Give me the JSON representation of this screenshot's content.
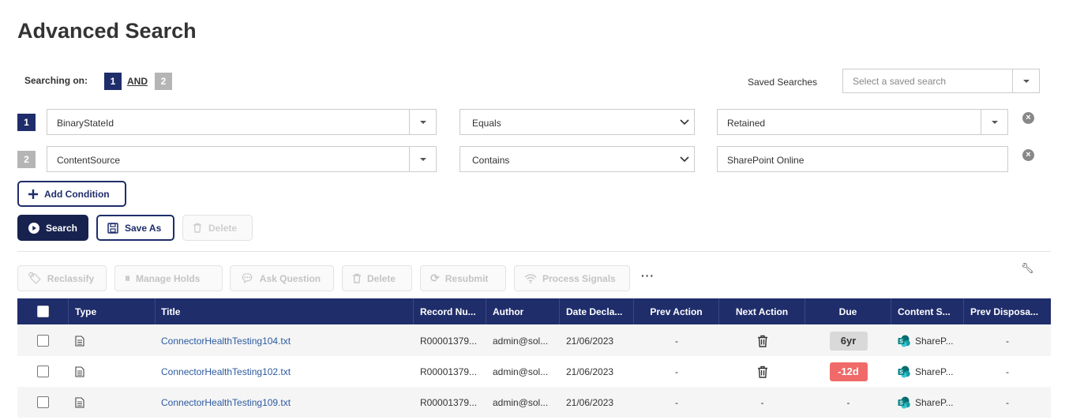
{
  "page_title": "Advanced Search",
  "searching": {
    "label": "Searching on:",
    "badge_1": "1",
    "operator": "AND",
    "badge_2": "2"
  },
  "saved_searches": {
    "label": "Saved Searches",
    "placeholder": "Select a saved search"
  },
  "conditions": [
    {
      "number": "1",
      "field": "BinaryStateId",
      "operator": "Equals",
      "value": "Retained"
    },
    {
      "number": "2",
      "field": "ContentSource",
      "operator": "Contains",
      "value": "SharePoint Online"
    }
  ],
  "buttons": {
    "add_condition": "Add Condition",
    "search": "Search",
    "save_as": "Save As",
    "delete": "Delete"
  },
  "toolbar": {
    "reclassify": "Reclassify",
    "manage_holds": "Manage Holds",
    "ask_question": "Ask Question",
    "delete": "Delete",
    "resubmit": "Resubmit",
    "process_signals": "Process Signals",
    "more": "···"
  },
  "table": {
    "columns": {
      "type": "Type",
      "title": "Title",
      "record_number": "Record Nu...",
      "author": "Author",
      "date_declared": "Date Decla...",
      "prev_action": "Prev Action",
      "next_action": "Next Action",
      "due": "Due",
      "content_source": "Content S...",
      "prev_disposal": "Prev Disposa..."
    },
    "rows": [
      {
        "title": "ConnectorHealthTesting104.txt",
        "record_number": "R00001379...",
        "author": "admin@sol...",
        "date_declared": "21/06/2023",
        "prev_action": "-",
        "next_action": "delete",
        "due": "6yr",
        "due_status": "gray",
        "content_source": "ShareP...",
        "prev_disposal": "-"
      },
      {
        "title": "ConnectorHealthTesting102.txt",
        "record_number": "R00001379...",
        "author": "admin@sol...",
        "date_declared": "21/06/2023",
        "prev_action": "-",
        "next_action": "delete",
        "due": "-12d",
        "due_status": "red",
        "content_source": "ShareP...",
        "prev_disposal": "-"
      },
      {
        "title": "ConnectorHealthTesting109.txt",
        "record_number": "R00001379...",
        "author": "admin@sol...",
        "date_declared": "21/06/2023",
        "prev_action": "-",
        "next_action": "-",
        "due": "-",
        "due_status": "none",
        "content_source": "ShareP...",
        "prev_disposal": "-"
      }
    ]
  },
  "colors": {
    "primary": "#1f2d6b",
    "button_dark": "#17224f",
    "overdue": "#f06a6a",
    "link": "#2c5aa0",
    "sharepoint": "#038387"
  }
}
